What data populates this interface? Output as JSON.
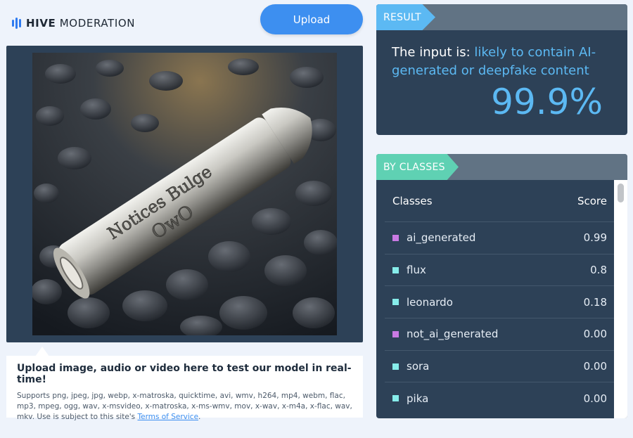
{
  "logo": {
    "brand": "HIVE",
    "product": "MODERATION",
    "icon": "bars-logo-icon",
    "color": "#2f7bf0"
  },
  "upload_button": {
    "label": "Upload"
  },
  "preview": {
    "image_alt": "Uploaded image: silver bullet engraved 'Notices Bulge OwO' on dark pebbles",
    "engraving_line1": "Notices Bulge",
    "engraving_line2": "OwO"
  },
  "info": {
    "title": "Upload image, audio or video here to test our model in real-time!",
    "supports": "Supports png, jpeg, jpg, webp, x-matroska, quicktime, avi, wmv, h264, mp4, webm, flac, mp3, mpeg, ogg, wav, x-msvideo, x-matroska, x-ms-wmv, mov, x-wav, x-m4a, x-flac, wav, mkv. Use is subject to this site's ",
    "tos_link": "Terms of Service",
    "tos_end": "."
  },
  "result": {
    "tag": "RESULT",
    "prefix": "The input is: ",
    "verdict": "likely to contain AI-generated or deepfake content",
    "percent": "99.9%"
  },
  "classes": {
    "tag": "BY CLASSES",
    "col_class": "Classes",
    "col_score": "Score",
    "rows": [
      {
        "name": "ai_generated",
        "score": "0.99",
        "color": "#c97ae3"
      },
      {
        "name": "flux",
        "score": "0.8",
        "color": "#86ecea"
      },
      {
        "name": "leonardo",
        "score": "0.18",
        "color": "#86ecea"
      },
      {
        "name": "not_ai_generated",
        "score": "0.00",
        "color": "#c97ae3"
      },
      {
        "name": "sora",
        "score": "0.00",
        "color": "#86ecea"
      },
      {
        "name": "pika",
        "score": "0.00",
        "color": "#86ecea"
      }
    ]
  },
  "colors": {
    "accent": "#3d8ff0",
    "panel": "#2d4157",
    "result_blue": "#5cb9f3",
    "classes_green": "#5fd1b3"
  }
}
